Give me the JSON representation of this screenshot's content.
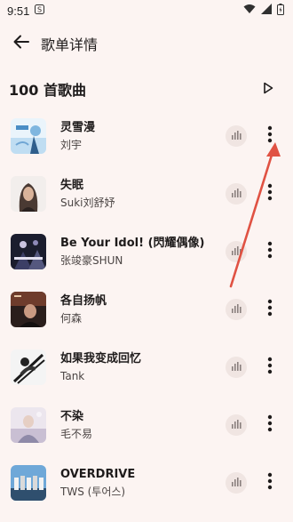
{
  "status_bar": {
    "time": "9:51",
    "icons": [
      "notification-s-icon",
      "wifi-icon",
      "signal-icon",
      "battery-icon"
    ]
  },
  "header": {
    "title": "歌单详情",
    "back_icon": "arrow-left-icon"
  },
  "list_header": {
    "count_label": "100 首歌曲",
    "play_icon": "play-triangle-outline-icon"
  },
  "songs": [
    {
      "title": "灵雪漫",
      "artist": "刘宇"
    },
    {
      "title": "失眠",
      "artist": "Suki刘舒妤"
    },
    {
      "title": "Be Your Idol! (閃耀偶像)",
      "artist": "张竣豪SHUN"
    },
    {
      "title": "各自扬帆",
      "artist": "何森"
    },
    {
      "title": "如果我变成回忆",
      "artist": "Tank"
    },
    {
      "title": "不染",
      "artist": "毛不易"
    },
    {
      "title": "OVERDRIVE",
      "artist": "TWS (투어스)"
    }
  ],
  "colors": {
    "background": "#FCF4F2",
    "eq_button_bg": "#F0E5E2",
    "annotation_arrow": "#E05243"
  }
}
